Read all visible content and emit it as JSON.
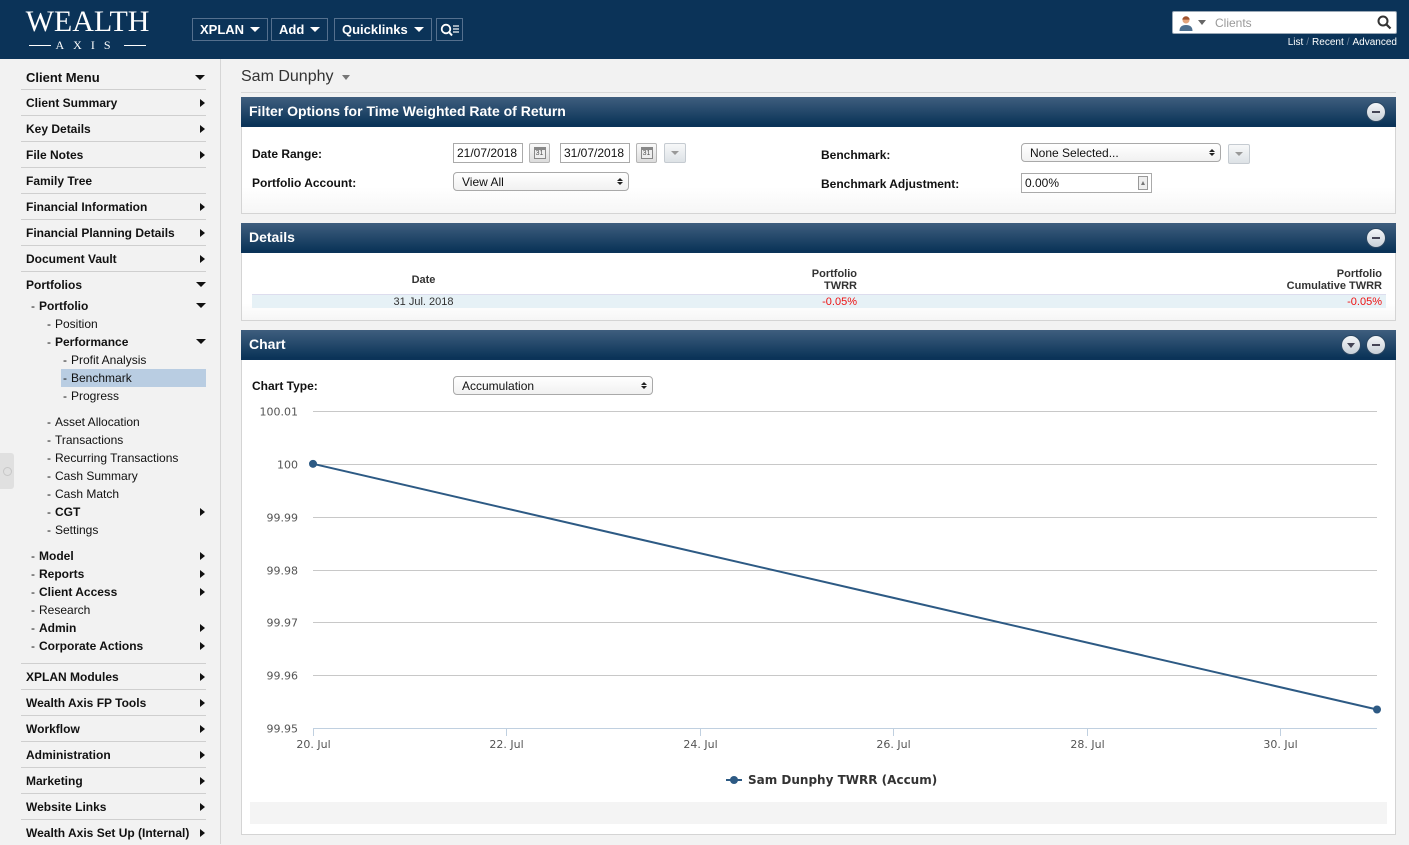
{
  "header": {
    "logo_top": "WEALTH",
    "logo_bottom": "AXIS",
    "nav": [
      {
        "label": "XPLAN"
      },
      {
        "label": "Add"
      },
      {
        "label": "Quicklinks"
      }
    ],
    "search": {
      "placeholder": "Clients",
      "links": [
        "List",
        "Recent",
        "Advanced"
      ]
    }
  },
  "sidebar": {
    "title": "Client Menu",
    "top_items": [
      {
        "label": "Client Summary",
        "arrow": "right"
      },
      {
        "label": "Key Details",
        "arrow": "right"
      },
      {
        "label": "File Notes",
        "arrow": "right"
      },
      {
        "label": "Family Tree",
        "arrow": "none"
      },
      {
        "label": "Financial Information",
        "arrow": "right"
      },
      {
        "label": "Financial Planning Details",
        "arrow": "right"
      },
      {
        "label": "Document Vault",
        "arrow": "right"
      },
      {
        "label": "Portfolios",
        "arrow": "down"
      }
    ],
    "portfolio": {
      "label": "Portfolio",
      "children": [
        {
          "label": "Position"
        },
        {
          "label": "Performance"
        },
        {
          "label": "Asset Allocation"
        },
        {
          "label": "Transactions"
        },
        {
          "label": "Recurring Transactions"
        },
        {
          "label": "Cash Summary"
        },
        {
          "label": "Cash Match"
        },
        {
          "label": "CGT"
        },
        {
          "label": "Settings"
        }
      ],
      "performance_children": [
        {
          "label": "Profit Analysis"
        },
        {
          "label": "Benchmark",
          "selected": true
        },
        {
          "label": "Progress"
        }
      ]
    },
    "portfolios_children": [
      {
        "label": "Model"
      },
      {
        "label": "Reports"
      },
      {
        "label": "Client Access"
      },
      {
        "label": "Research"
      },
      {
        "label": "Admin"
      },
      {
        "label": "Corporate Actions"
      }
    ],
    "bottom_items": [
      {
        "label": "XPLAN Modules"
      },
      {
        "label": "Wealth Axis FP Tools"
      },
      {
        "label": "Workflow"
      },
      {
        "label": "Administration"
      },
      {
        "label": "Marketing"
      },
      {
        "label": "Website Links"
      },
      {
        "label": "Wealth Axis Set Up (Internal)"
      }
    ]
  },
  "main": {
    "client_name": "Sam Dunphy",
    "filter": {
      "title": "Filter Options for Time Weighted Rate of Return",
      "date_range_label": "Date Range:",
      "date_from": "21/07/2018",
      "date_to": "31/07/2018",
      "calendar_day": "31",
      "portfolio_account_label": "Portfolio Account:",
      "portfolio_account_value": "View All",
      "benchmark_label": "Benchmark:",
      "benchmark_value": "None Selected...",
      "benchmark_adjustment_label": "Benchmark Adjustment:",
      "benchmark_adjustment_value": "0.00%"
    },
    "details": {
      "title": "Details",
      "columns": [
        {
          "line1": "",
          "line2": "Date"
        },
        {
          "line1": "Portfolio",
          "line2": "TWRR"
        },
        {
          "line1": "Portfolio",
          "line2": "Cumulative TWRR"
        }
      ],
      "rows": [
        {
          "date": "31 Jul. 2018",
          "twrr": "-0.05%",
          "cumulative_twrr": "-0.05%"
        }
      ]
    },
    "chart_panel": {
      "title": "Chart",
      "chart_type_label": "Chart Type:",
      "chart_type_value": "Accumulation"
    }
  },
  "colors": {
    "brand_navy": "#0b3358",
    "series": "#2d5a84",
    "negative": "#ee1111",
    "selected_menu": "#b9cde2"
  },
  "chart_data": {
    "type": "line",
    "title": "",
    "xlabel": "",
    "ylabel": "",
    "x_ticks": [
      "20. Jul",
      "22. Jul",
      "24. Jul",
      "26. Jul",
      "28. Jul",
      "30. Jul"
    ],
    "x_tick_days": [
      20,
      22,
      24,
      26,
      28,
      30
    ],
    "xlim": [
      20,
      31
    ],
    "y_ticks": [
      "100.01",
      "100",
      "99.99",
      "99.98",
      "99.97",
      "99.96",
      "99.95"
    ],
    "y_tick_values": [
      100.01,
      100,
      99.99,
      99.98,
      99.97,
      99.96,
      99.95
    ],
    "ylim": [
      99.95,
      100.01
    ],
    "grid": true,
    "legend_position": "bottom-center",
    "series": [
      {
        "name": "Sam Dunphy TWRR (Accum)",
        "x": [
          20,
          31
        ],
        "x_labels": [
          "20 Jul 2018",
          "31 Jul 2018"
        ],
        "values": [
          100,
          99.9535
        ]
      }
    ]
  }
}
